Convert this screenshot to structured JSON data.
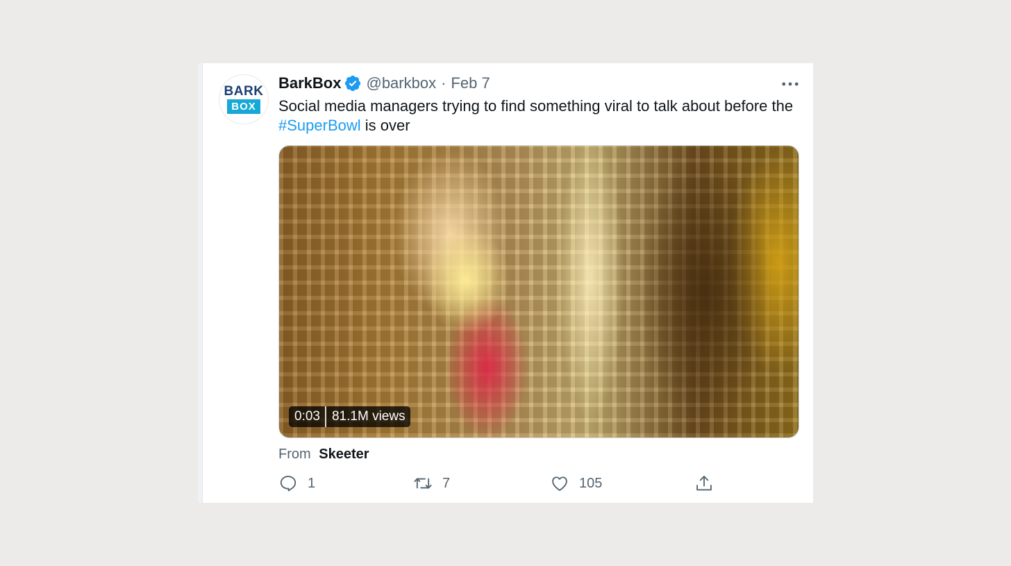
{
  "author": {
    "name": "BarkBox",
    "handle": "@barkbox",
    "date": "Feb 7",
    "separator": "·",
    "verified": true,
    "avatar": {
      "line1": "BARK",
      "line2": "BOX"
    }
  },
  "tweet": {
    "text_before": "Social media managers trying to find something viral to talk about before the ",
    "hashtag": "#SuperBowl",
    "text_after": " is over"
  },
  "media": {
    "duration": "0:03",
    "views": "81.1M views"
  },
  "source": {
    "label": "From",
    "name": "Skeeter"
  },
  "actions": {
    "replies": "1",
    "retweets": "7",
    "likes": "105"
  },
  "icons": [
    "verified-badge-icon",
    "more-options-icon",
    "reply-icon",
    "retweet-icon",
    "like-icon",
    "share-icon"
  ],
  "colors": {
    "link": "#1d9bf0",
    "secondary_text": "#536471",
    "primary_text": "#0f1419",
    "background": "#ecebe9"
  }
}
